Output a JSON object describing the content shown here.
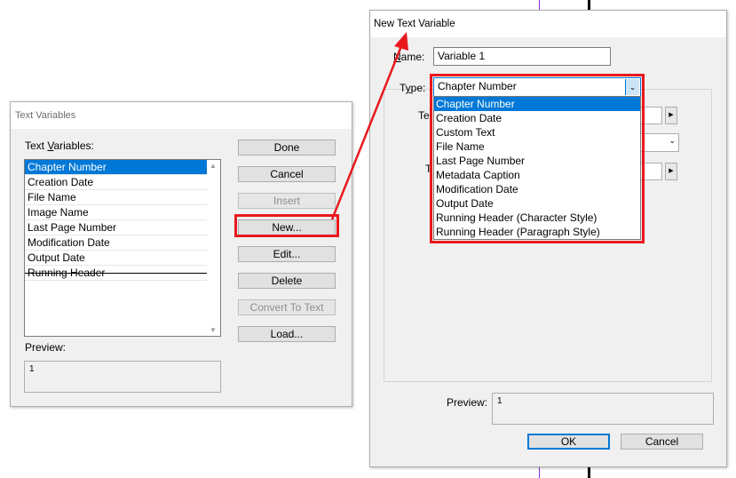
{
  "text_variables_dialog": {
    "title": "Text Variables",
    "list_label_pre": "Text ",
    "list_label_u": "V",
    "list_label_post": "ariables:",
    "items": [
      "Chapter Number",
      "Creation Date",
      "File Name",
      "Image Name",
      "Last Page Number",
      "Modification Date",
      "Output Date",
      "Running Header"
    ],
    "selected": "Chapter Number",
    "buttons": {
      "done": "Done",
      "cancel": "Cancel",
      "insert": "Insert",
      "new": "New...",
      "edit": "Edit...",
      "delete": "Delete",
      "convert": "Convert To Text",
      "load": "Load..."
    },
    "preview_label": "Preview:",
    "preview_value": "1"
  },
  "new_text_variable_dialog": {
    "title": "New Text Variable",
    "name_label_u": "N",
    "name_label_post": "ame:",
    "name_value": "Variable 1",
    "type_label_pre": "T",
    "type_label_u": "y",
    "type_label_post": "pe:",
    "type_value": "Chapter Number",
    "type_options": [
      "Chapter Number",
      "Creation Date",
      "Custom Text",
      "File Name",
      "Last Page Number",
      "Metadata Caption",
      "Modification Date",
      "Output Date",
      "Running Header (Character Style)",
      "Running Header (Paragraph Style)"
    ],
    "partial_label_1": "Te",
    "partial_label_2": "T",
    "preview_label": "Preview:",
    "preview_value": "1",
    "ok_label": "OK",
    "cancel_label": "Cancel"
  },
  "colors": {
    "highlight": "#e8191e",
    "selection": "#0078d7"
  }
}
